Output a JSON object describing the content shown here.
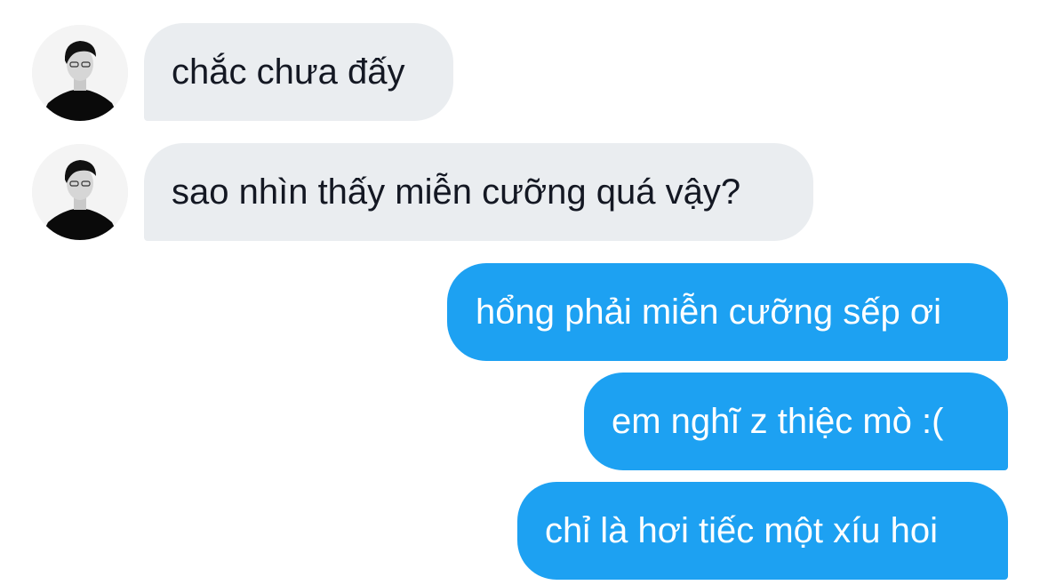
{
  "conversation": {
    "received": [
      {
        "text": "chắc chưa đấy",
        "avatar": "user-avatar"
      },
      {
        "text": "sao nhìn thấy miễn cưỡng quá vậy?",
        "avatar": "user-avatar"
      }
    ],
    "sent": [
      {
        "text": "hổng phải miễn cưỡng sếp ơi"
      },
      {
        "text": "em nghĩ z thiệc mò :("
      },
      {
        "text": "chỉ là hơi tiếc một xíu hoi"
      }
    ]
  },
  "colors": {
    "received_bubble": "#eaedf0",
    "received_text": "#141823",
    "sent_bubble": "#1da1f2",
    "sent_text": "#ffffff",
    "background": "#ffffff"
  }
}
